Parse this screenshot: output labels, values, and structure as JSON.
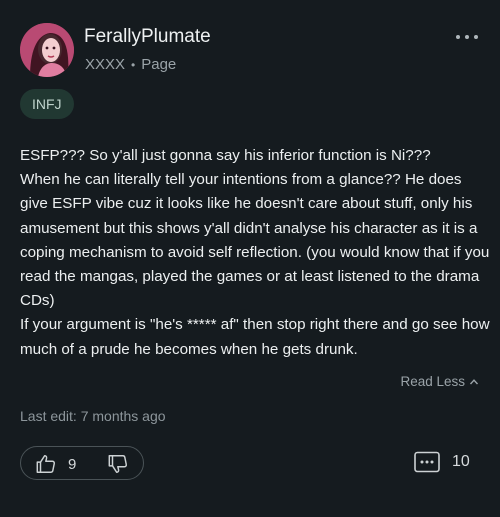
{
  "post": {
    "username": "FerallyPlumate",
    "author_meta": "XXXX",
    "separator": "•",
    "page_label": "Page",
    "mbti_badge": "INFJ",
    "body": "ESFP??? So y'all just gonna say his inferior function is Ni???\nWhen he can literally tell your intentions from a glance?? He does give ESFP vibe cuz it looks like he doesn't care about stuff, only his amusement but this shows y'all didn't analyse his character as it is a coping mechanism to avoid self reflection. (you would know that if you read the mangas, played the games or at least listened to the drama CDs)\nIf your argument is \"he's ***** af\" then stop right there and go see how much of a prude he becomes when he gets drunk.",
    "read_less_label": "Read Less",
    "last_edit": "Last edit: 7 months ago"
  },
  "actions": {
    "upvote_count": "9",
    "comment_count": "10"
  },
  "icons": {
    "more": "more-horizontal-icon",
    "upvote": "thumbs-up-icon",
    "downvote": "thumbs-down-icon",
    "comment": "comment-icon",
    "read_less": "chevron-up-icon"
  },
  "colors": {
    "background": "#151b1f",
    "badge_bg": "#213832",
    "badge_text": "#bfd3cc",
    "muted_text": "#9aa3a8"
  }
}
